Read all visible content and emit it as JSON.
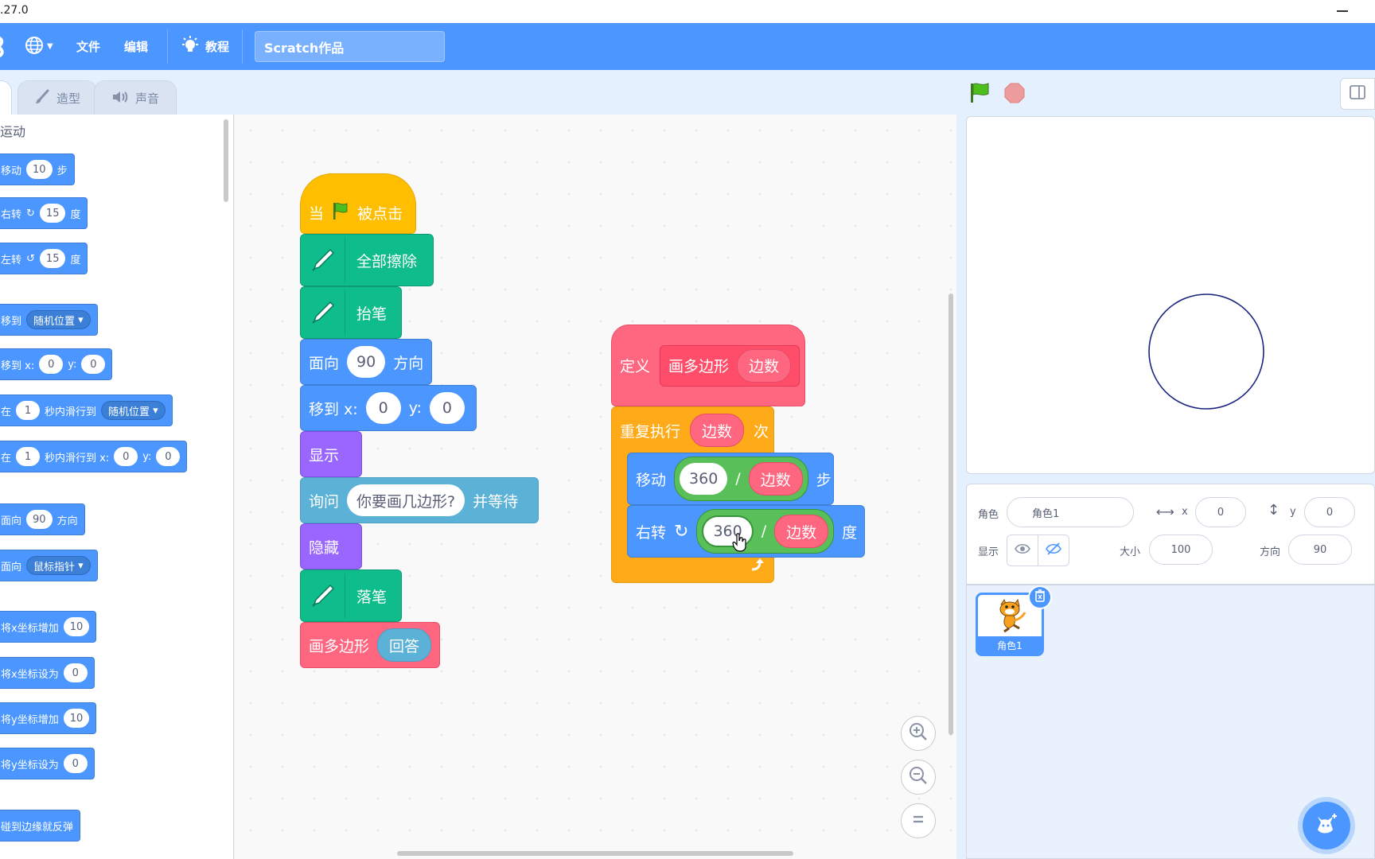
{
  "window": {
    "version": ".27.0"
  },
  "menubar": {
    "file": "文件",
    "edit": "编辑",
    "tutorials": "教程",
    "project_title": "Scratch作品"
  },
  "tabs": {
    "costumes": "造型",
    "sounds": "声音"
  },
  "palette": {
    "category": "运动",
    "blocks": [
      {
        "pre": "移动",
        "v1": "10",
        "post": "步"
      },
      {
        "pre": "右转",
        "v1": "15",
        "post": "度"
      },
      {
        "pre": "左转",
        "v1": "15",
        "post": "度"
      },
      {
        "pre": "移到",
        "dd": "随机位置"
      },
      {
        "pre": "移到 x:",
        "v1": "0",
        "mid": "y:",
        "v2": "0"
      },
      {
        "pre": "在",
        "v1": "1",
        "mid": "秒内滑行到",
        "dd": "随机位置"
      },
      {
        "pre": "在",
        "v1": "1",
        "mid": "秒内滑行到 x:",
        "v2": "0",
        "mid2": "y:",
        "v3": "0"
      },
      {
        "pre": "面向",
        "v1": "90",
        "post": "方向"
      },
      {
        "pre": "面向",
        "dd": "鼠标指针"
      },
      {
        "pre": "将x坐标增加",
        "v1": "10"
      },
      {
        "pre": "将x坐标设为",
        "v1": "0"
      },
      {
        "pre": "将y坐标增加",
        "v1": "10"
      },
      {
        "pre": "将y坐标设为",
        "v1": "0"
      },
      {
        "pre": "碰到边缘就反弹"
      }
    ]
  },
  "script1": {
    "when_pre": "当",
    "when_post": "被点击",
    "erase_all": "全部擦除",
    "pen_up": "抬笔",
    "point_pre": "面向",
    "point_val": "90",
    "point_post": "方向",
    "goto_pre": "移到 x:",
    "goto_x": "0",
    "goto_y_label": "y:",
    "goto_y": "0",
    "show": "显示",
    "ask_pre": "询问",
    "ask_val": "你要画几边形?",
    "ask_post": "并等待",
    "hide": "隐藏",
    "pen_down": "落笔",
    "call_name": "画多边形",
    "call_arg": "回答"
  },
  "script2": {
    "define": "定义",
    "proc_name": "画多边形",
    "proc_param": "边数",
    "repeat_pre": "重复执行",
    "repeat_arg": "边数",
    "repeat_post": "次",
    "move_pre": "移动",
    "move_num": "360",
    "div": "/",
    "move_den": "边数",
    "move_post": "步",
    "turn_pre": "右转",
    "turn_num": "360",
    "turn_den": "边数",
    "turn_post": "度"
  },
  "sprite_info": {
    "sprite_label": "角色",
    "sprite_name": "角色1",
    "x_label": "x",
    "x_value": "0",
    "y_label": "y",
    "y_value": "0",
    "show_label": "显示",
    "size_label": "大小",
    "size_value": "100",
    "direction_label": "方向",
    "direction_value": "90"
  },
  "sprites": [
    {
      "name": "角色1"
    }
  ],
  "colors": {
    "motion": "#4c97ff",
    "pen": "#0fbd8c",
    "looks": "#9966ff",
    "sensing": "#5cb1d6",
    "custom": "#ff6680",
    "control": "#ffab19",
    "operator": "#59c059",
    "event": "#ffbf00"
  }
}
